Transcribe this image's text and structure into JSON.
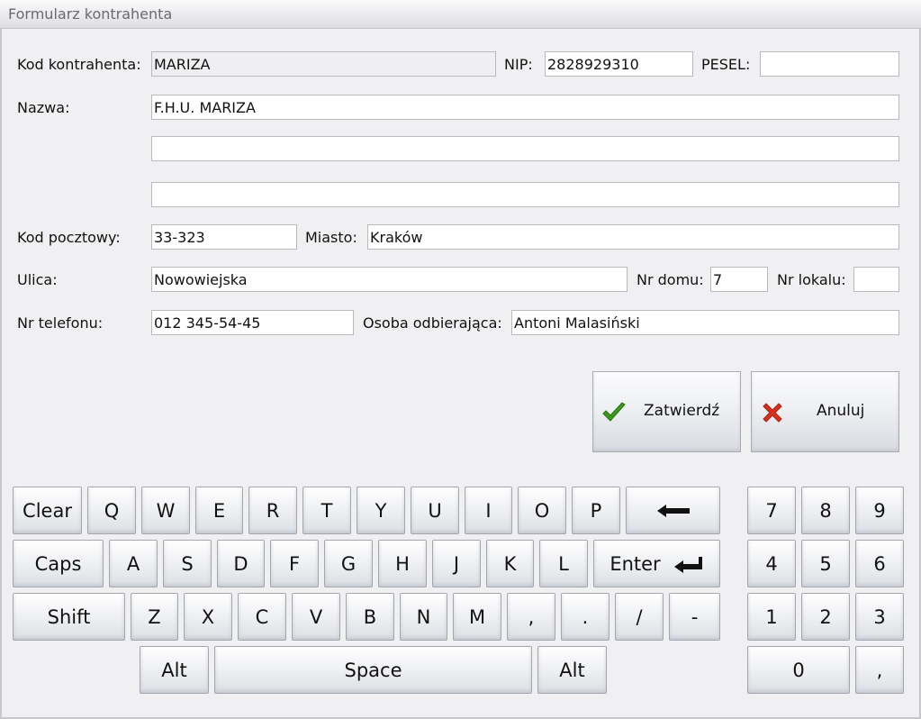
{
  "window": {
    "title": "Formularz kontrahenta"
  },
  "form": {
    "kod_label": "Kod kontrahenta:",
    "kod_value": "MARIZA",
    "nip_label": "NIP:",
    "nip_value": "2828929310",
    "pesel_label": "PESEL:",
    "pesel_value": "",
    "nazwa_label": "Nazwa:",
    "nazwa_value": "F.H.U. MARIZA",
    "nazwa2_value": "",
    "nazwa3_value": "",
    "kodpocz_label": "Kod pocztowy:",
    "kodpocz_value": "33-323",
    "miasto_label": "Miasto:",
    "miasto_value": "Kraków",
    "ulica_label": "Ulica:",
    "ulica_value": "Nowowiejska",
    "nrdomu_label": "Nr domu:",
    "nrdomu_value": "7",
    "nrlokalu_label": "Nr lokalu:",
    "nrlokalu_value": "",
    "tel_label": "Nr telefonu:",
    "tel_value": "012 345-54-45",
    "osoba_label": "Osoba odbierająca:",
    "osoba_value": "Antoni Malasiński"
  },
  "actions": {
    "confirm_label": "Zatwierdź",
    "confirm_icon": "checkmark-icon",
    "confirm_color": "#3a9a1c",
    "cancel_label": "Anuluj",
    "cancel_icon": "x-icon",
    "cancel_color": "#d83020"
  },
  "keyboard": {
    "row1": [
      "Clear",
      "Q",
      "W",
      "E",
      "R",
      "T",
      "Y",
      "U",
      "I",
      "O",
      "P"
    ],
    "backspace_icon": "backspace-arrow-icon",
    "row2": [
      "Caps",
      "A",
      "S",
      "D",
      "F",
      "G",
      "H",
      "J",
      "K",
      "L"
    ],
    "enter_label": "Enter",
    "enter_icon": "enter-return-icon",
    "row3": [
      "Shift",
      "Z",
      "X",
      "C",
      "V",
      "B",
      "N",
      "M",
      ",",
      ".",
      "/",
      "-"
    ],
    "row4": [
      "Alt",
      "Space",
      "Alt"
    ]
  },
  "numpad": {
    "row1": [
      "7",
      "8",
      "9"
    ],
    "row2": [
      "4",
      "5",
      "6"
    ],
    "row3": [
      "1",
      "2",
      "3"
    ],
    "row4": [
      "0",
      ","
    ]
  }
}
